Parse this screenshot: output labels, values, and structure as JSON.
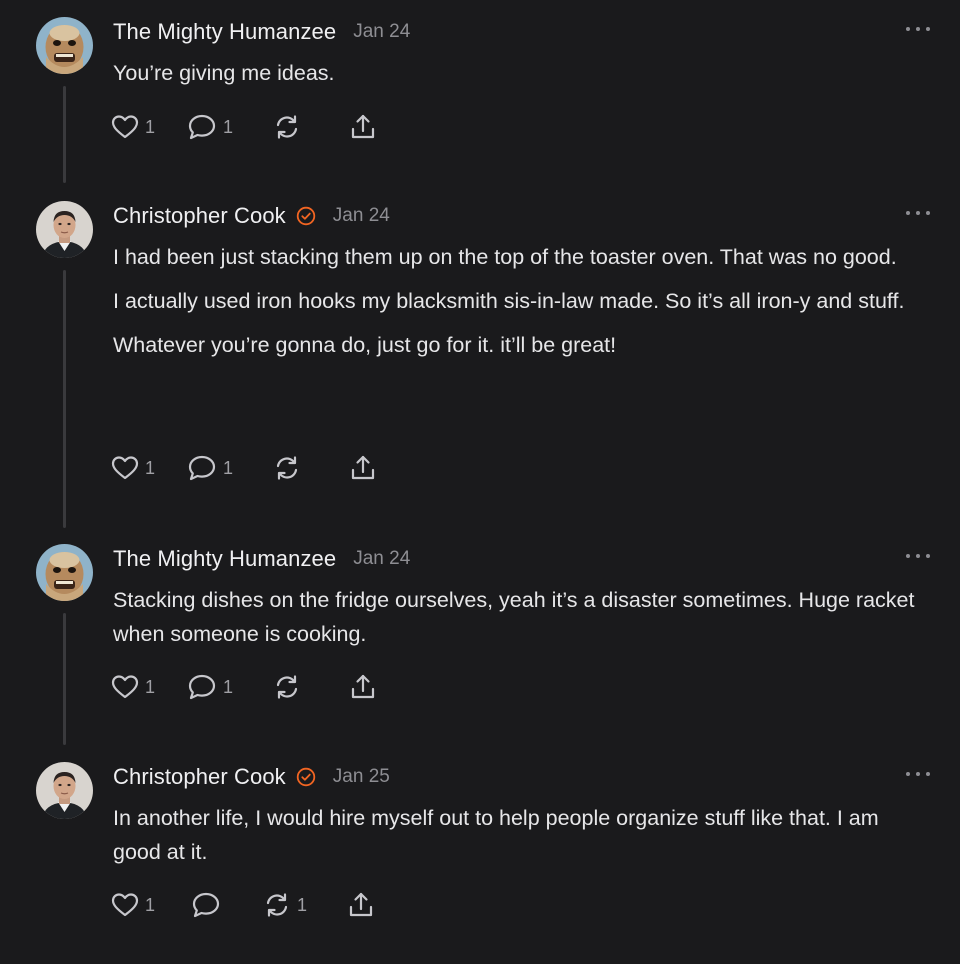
{
  "colors": {
    "background": "#1a1a1c",
    "verified_badge": "#f26522",
    "muted": "#8e8e93"
  },
  "comments": [
    {
      "author": "The Mighty Humanzee",
      "verified": false,
      "date": "Jan 24",
      "paragraphs": [
        "You’re giving me ideas."
      ],
      "likes": "1",
      "replies": "1",
      "restacks": ""
    },
    {
      "author": "Christopher Cook",
      "verified": true,
      "date": "Jan 24",
      "paragraphs": [
        "I had been just stacking them up on the top of the toaster oven. That was no good.",
        "I actually used iron hooks my blacksmith sis-in-law made. So it’s all iron-y and stuff.",
        "Whatever you’re gonna do, just go for it. it’ll be great!"
      ],
      "likes": "1",
      "replies": "1",
      "restacks": ""
    },
    {
      "author": "The Mighty Humanzee",
      "verified": false,
      "date": "Jan 24",
      "paragraphs": [
        "Stacking dishes on the fridge ourselves, yeah it’s a disaster sometimes. Huge racket when someone is cooking."
      ],
      "likes": "1",
      "replies": "1",
      "restacks": ""
    },
    {
      "author": "Christopher Cook",
      "verified": true,
      "date": "Jan 25",
      "paragraphs": [
        "In another life, I would hire myself out to help people organize stuff like that. I am good at it."
      ],
      "likes": "1",
      "replies": "",
      "restacks": "1"
    }
  ]
}
